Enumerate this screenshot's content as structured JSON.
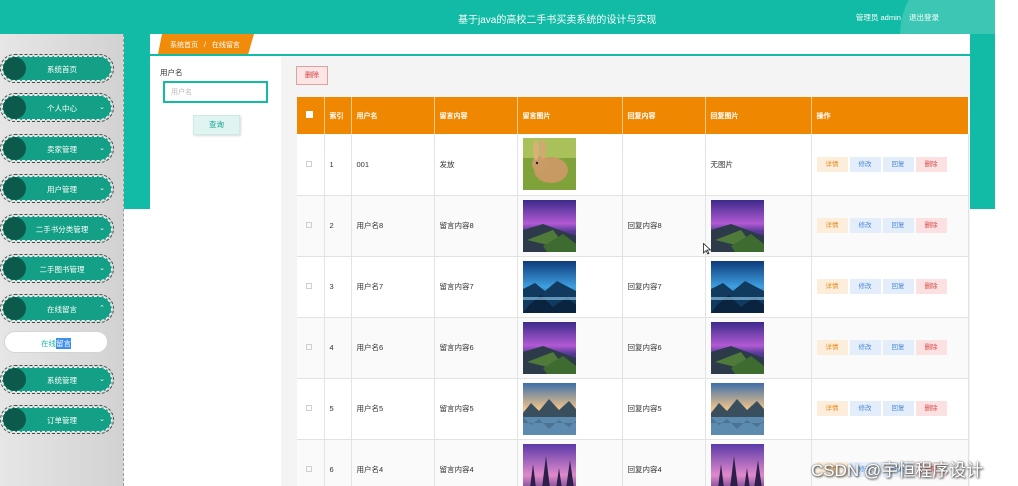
{
  "header": {
    "title": "基于java的高校二手书买卖系统的设计与实现",
    "user_label": "管理员 admin",
    "logout": "退出登录"
  },
  "sidebar": {
    "items": [
      {
        "label": "系统首页",
        "expandable": false
      },
      {
        "label": "个人中心",
        "expandable": true
      },
      {
        "label": "卖家管理",
        "expandable": true
      },
      {
        "label": "用户管理",
        "expandable": true
      },
      {
        "label": "二手书分类管理",
        "expandable": true
      },
      {
        "label": "二手图书管理",
        "expandable": true
      },
      {
        "label": "在线留言",
        "expandable": true,
        "expanded": true
      },
      {
        "label": "系统管理",
        "expandable": true
      },
      {
        "label": "订单管理",
        "expandable": true
      }
    ],
    "sub_item": {
      "prefix": "在线",
      "selected": "留言"
    }
  },
  "breadcrumb": {
    "home": "系统首页",
    "separator": "/",
    "current": "在线留言"
  },
  "search": {
    "label": "用户名",
    "placeholder": "用户名",
    "value": "",
    "button": "查询"
  },
  "toolbar": {
    "delete": "删除"
  },
  "table": {
    "columns": [
      "",
      "索引",
      "用户名",
      "留言内容",
      "留言图片",
      "回复内容",
      "回复图片",
      "操作"
    ],
    "rows": [
      {
        "index": "1",
        "username": "001",
        "content": "发放",
        "image": "rabbit",
        "reply": "",
        "reply_image": "",
        "reply_image_text": "无图片"
      },
      {
        "index": "2",
        "username": "用户名8",
        "content": "留言内容8",
        "image": "coast-purple",
        "reply": "回复内容8",
        "reply_image": "coast-purple",
        "reply_image_text": ""
      },
      {
        "index": "3",
        "username": "用户名7",
        "content": "留言内容7",
        "image": "coast-blue",
        "reply": "回复内容7",
        "reply_image": "coast-blue",
        "reply_image_text": ""
      },
      {
        "index": "4",
        "username": "用户名6",
        "content": "留言内容6",
        "image": "coast-purple",
        "reply": "回复内容6",
        "reply_image": "coast-purple",
        "reply_image_text": ""
      },
      {
        "index": "5",
        "username": "用户名5",
        "content": "留言内容5",
        "image": "lake-mountains",
        "reply": "回复内容5",
        "reply_image": "lake-mountains",
        "reply_image_text": ""
      },
      {
        "index": "6",
        "username": "用户名4",
        "content": "留言内容4",
        "image": "forest-pink",
        "reply": "回复内容4",
        "reply_image": "forest-pink",
        "reply_image_text": ""
      }
    ],
    "actions": [
      "详情",
      "修改",
      "回复",
      "删除"
    ]
  },
  "colors": {
    "teal": "#12bba5",
    "orange": "#f08700",
    "sidebar_teal": "#14a086"
  },
  "watermark": "CSDN @宇恒程序设计"
}
